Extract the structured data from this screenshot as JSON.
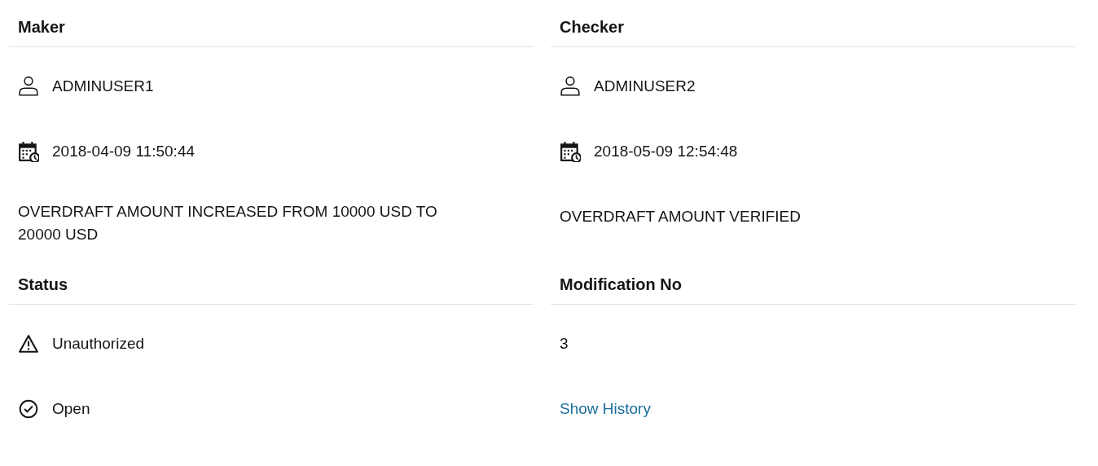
{
  "sections": [
    {
      "heading": "Maker",
      "items": [
        {
          "kind": "user",
          "text": "ADMINUSER1"
        },
        {
          "kind": "datetime",
          "text": "2018-04-09 11:50:44"
        },
        {
          "kind": "text",
          "text": "OVERDRAFT AMOUNT INCREASED FROM 10000 USD TO 20000 USD"
        }
      ]
    },
    {
      "heading": "Checker",
      "items": [
        {
          "kind": "user",
          "text": "ADMINUSER2"
        },
        {
          "kind": "datetime",
          "text": "2018-05-09 12:54:48"
        },
        {
          "kind": "text",
          "text": "OVERDRAFT AMOUNT VERIFIED"
        }
      ]
    },
    {
      "heading": "Status",
      "items": [
        {
          "kind": "warning",
          "text": "Unauthorized"
        },
        {
          "kind": "check",
          "text": "Open"
        }
      ]
    },
    {
      "heading": "Modification No",
      "items": [
        {
          "kind": "text",
          "text": "3"
        },
        {
          "kind": "link",
          "text": "Show History"
        }
      ]
    }
  ]
}
